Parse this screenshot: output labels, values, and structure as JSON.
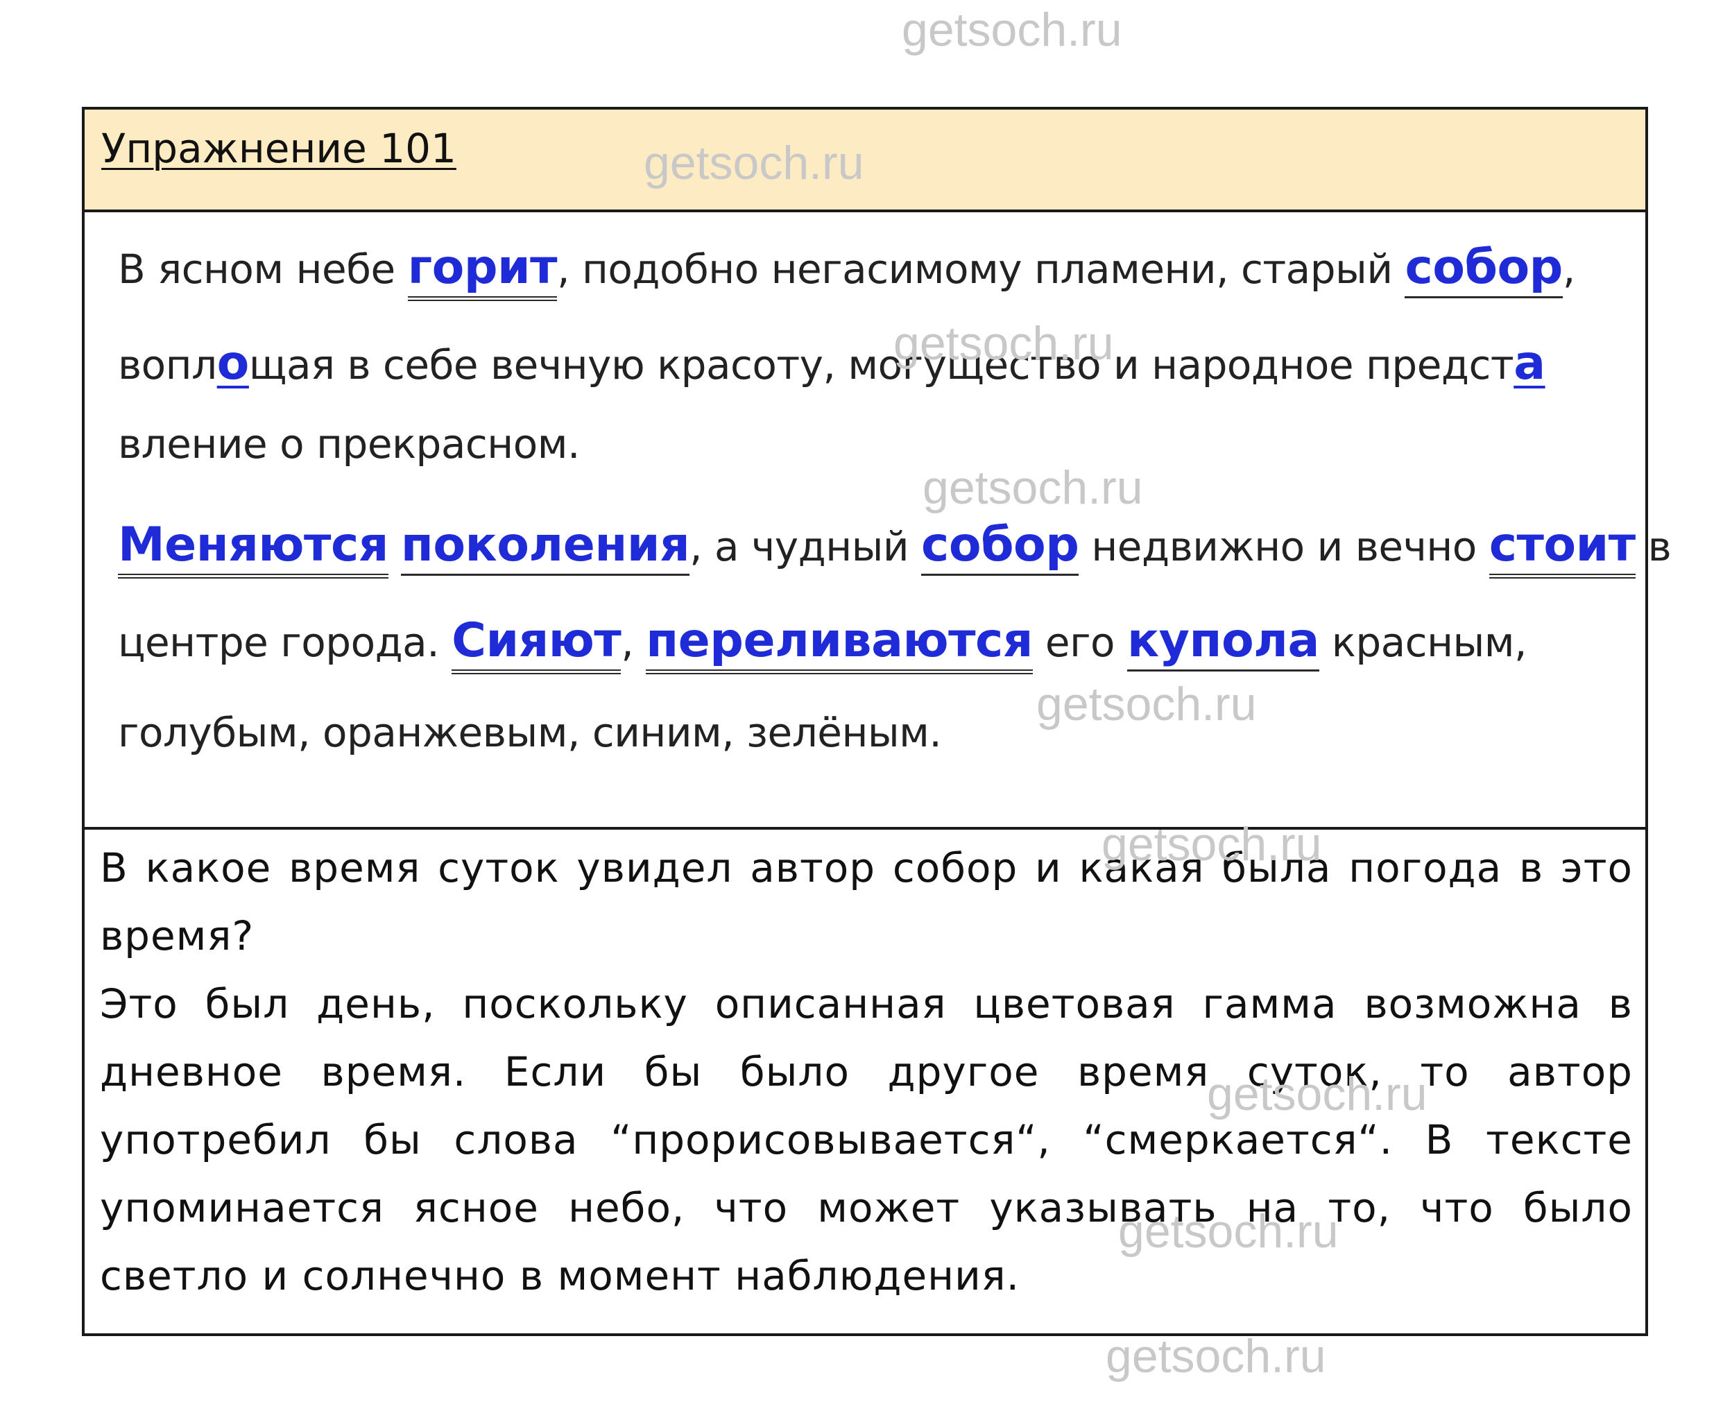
{
  "watermark": "getsoch.ru",
  "header": {
    "title": "Упражнение 101"
  },
  "text": {
    "l1a": "В ясном небе ",
    "l1_gorit": "горит",
    "l1b": ", подобно негасимому пламени, старый ",
    "l1_sobor": "собор",
    "l1c": ",",
    "l2a": "вопл",
    "l2_o": "о",
    "l2b": "щая в себе вечную красоту, могущество и народное предст",
    "l2_a": "а",
    "l3": "вление о прекрасном.",
    "l4_menyayutsya": "Меняются",
    "l4_pokoleniya": "поколения",
    "l4a": ", а чудный ",
    "l4_sobor": "собор",
    "l4b": " недвижно и вечно ",
    "l4_stoit": "стоит",
    "l4c": " в",
    "l5a": "центре города. ",
    "l5_siyayut": "Сияют",
    "l5b": ", ",
    "l5_perelivayutsya": "переливаются",
    "l5c": " его ",
    "l5_kupola": "купола",
    "l5d": " красным,",
    "l6": "голубым, оранжевым, синим, зелёным."
  },
  "answer": {
    "question": "В какое время суток увидел автор собор и какая была погода в это время?",
    "response": "Это был день, поскольку описанная цветовая гамма возможна в дневное время. Если бы было другое время суток, то автор употребил бы слова “прорисовывается“, “смеркается“. В тексте упоминается ясное небо, что может указывать на то, что было светло и солнечно в момент наблюдения."
  }
}
